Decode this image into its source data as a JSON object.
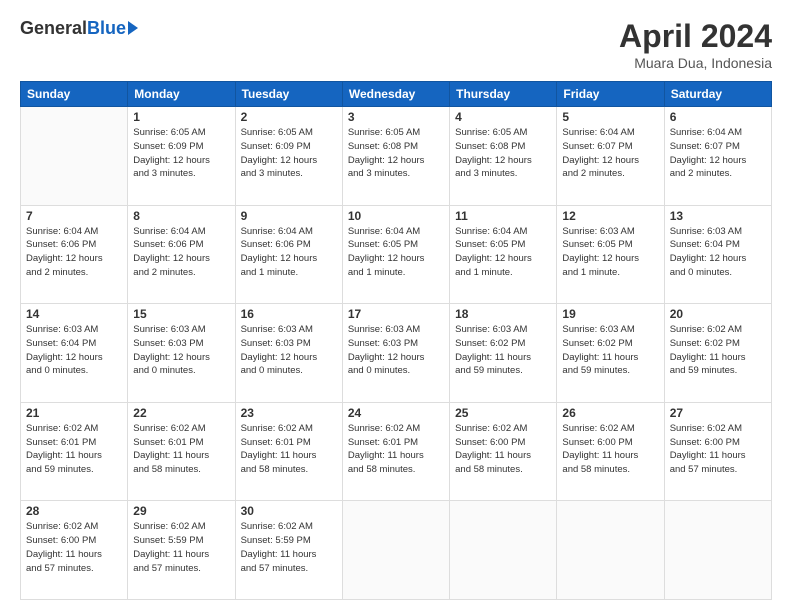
{
  "logo": {
    "general": "General",
    "blue": "Blue"
  },
  "title": "April 2024",
  "location": "Muara Dua, Indonesia",
  "weekdays": [
    "Sunday",
    "Monday",
    "Tuesday",
    "Wednesday",
    "Thursday",
    "Friday",
    "Saturday"
  ],
  "weeks": [
    [
      {
        "day": "",
        "info": ""
      },
      {
        "day": "1",
        "info": "Sunrise: 6:05 AM\nSunset: 6:09 PM\nDaylight: 12 hours\nand 3 minutes."
      },
      {
        "day": "2",
        "info": "Sunrise: 6:05 AM\nSunset: 6:09 PM\nDaylight: 12 hours\nand 3 minutes."
      },
      {
        "day": "3",
        "info": "Sunrise: 6:05 AM\nSunset: 6:08 PM\nDaylight: 12 hours\nand 3 minutes."
      },
      {
        "day": "4",
        "info": "Sunrise: 6:05 AM\nSunset: 6:08 PM\nDaylight: 12 hours\nand 3 minutes."
      },
      {
        "day": "5",
        "info": "Sunrise: 6:04 AM\nSunset: 6:07 PM\nDaylight: 12 hours\nand 2 minutes."
      },
      {
        "day": "6",
        "info": "Sunrise: 6:04 AM\nSunset: 6:07 PM\nDaylight: 12 hours\nand 2 minutes."
      }
    ],
    [
      {
        "day": "7",
        "info": "Sunrise: 6:04 AM\nSunset: 6:06 PM\nDaylight: 12 hours\nand 2 minutes."
      },
      {
        "day": "8",
        "info": "Sunrise: 6:04 AM\nSunset: 6:06 PM\nDaylight: 12 hours\nand 2 minutes."
      },
      {
        "day": "9",
        "info": "Sunrise: 6:04 AM\nSunset: 6:06 PM\nDaylight: 12 hours\nand 1 minute."
      },
      {
        "day": "10",
        "info": "Sunrise: 6:04 AM\nSunset: 6:05 PM\nDaylight: 12 hours\nand 1 minute."
      },
      {
        "day": "11",
        "info": "Sunrise: 6:04 AM\nSunset: 6:05 PM\nDaylight: 12 hours\nand 1 minute."
      },
      {
        "day": "12",
        "info": "Sunrise: 6:03 AM\nSunset: 6:05 PM\nDaylight: 12 hours\nand 1 minute."
      },
      {
        "day": "13",
        "info": "Sunrise: 6:03 AM\nSunset: 6:04 PM\nDaylight: 12 hours\nand 0 minutes."
      }
    ],
    [
      {
        "day": "14",
        "info": "Sunrise: 6:03 AM\nSunset: 6:04 PM\nDaylight: 12 hours\nand 0 minutes."
      },
      {
        "day": "15",
        "info": "Sunrise: 6:03 AM\nSunset: 6:03 PM\nDaylight: 12 hours\nand 0 minutes."
      },
      {
        "day": "16",
        "info": "Sunrise: 6:03 AM\nSunset: 6:03 PM\nDaylight: 12 hours\nand 0 minutes."
      },
      {
        "day": "17",
        "info": "Sunrise: 6:03 AM\nSunset: 6:03 PM\nDaylight: 12 hours\nand 0 minutes."
      },
      {
        "day": "18",
        "info": "Sunrise: 6:03 AM\nSunset: 6:02 PM\nDaylight: 11 hours\nand 59 minutes."
      },
      {
        "day": "19",
        "info": "Sunrise: 6:03 AM\nSunset: 6:02 PM\nDaylight: 11 hours\nand 59 minutes."
      },
      {
        "day": "20",
        "info": "Sunrise: 6:02 AM\nSunset: 6:02 PM\nDaylight: 11 hours\nand 59 minutes."
      }
    ],
    [
      {
        "day": "21",
        "info": "Sunrise: 6:02 AM\nSunset: 6:01 PM\nDaylight: 11 hours\nand 59 minutes."
      },
      {
        "day": "22",
        "info": "Sunrise: 6:02 AM\nSunset: 6:01 PM\nDaylight: 11 hours\nand 58 minutes."
      },
      {
        "day": "23",
        "info": "Sunrise: 6:02 AM\nSunset: 6:01 PM\nDaylight: 11 hours\nand 58 minutes."
      },
      {
        "day": "24",
        "info": "Sunrise: 6:02 AM\nSunset: 6:01 PM\nDaylight: 11 hours\nand 58 minutes."
      },
      {
        "day": "25",
        "info": "Sunrise: 6:02 AM\nSunset: 6:00 PM\nDaylight: 11 hours\nand 58 minutes."
      },
      {
        "day": "26",
        "info": "Sunrise: 6:02 AM\nSunset: 6:00 PM\nDaylight: 11 hours\nand 58 minutes."
      },
      {
        "day": "27",
        "info": "Sunrise: 6:02 AM\nSunset: 6:00 PM\nDaylight: 11 hours\nand 57 minutes."
      }
    ],
    [
      {
        "day": "28",
        "info": "Sunrise: 6:02 AM\nSunset: 6:00 PM\nDaylight: 11 hours\nand 57 minutes."
      },
      {
        "day": "29",
        "info": "Sunrise: 6:02 AM\nSunset: 5:59 PM\nDaylight: 11 hours\nand 57 minutes."
      },
      {
        "day": "30",
        "info": "Sunrise: 6:02 AM\nSunset: 5:59 PM\nDaylight: 11 hours\nand 57 minutes."
      },
      {
        "day": "",
        "info": ""
      },
      {
        "day": "",
        "info": ""
      },
      {
        "day": "",
        "info": ""
      },
      {
        "day": "",
        "info": ""
      }
    ]
  ]
}
